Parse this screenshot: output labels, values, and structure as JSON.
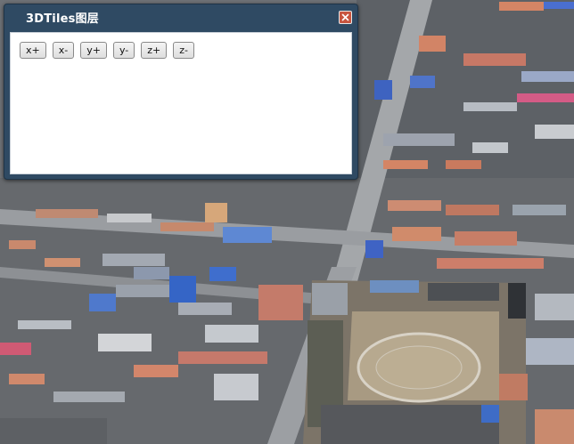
{
  "panel": {
    "title": "3DTiles图层",
    "close_icon": "close-icon"
  },
  "toolbar": {
    "buttons": [
      {
        "label": "x+"
      },
      {
        "label": "x-"
      },
      {
        "label": "y+"
      },
      {
        "label": "y-"
      },
      {
        "label": "z+"
      },
      {
        "label": "z-"
      }
    ]
  },
  "colors": {
    "panel_frame": "#2f4a63",
    "close_button": "#c8553f",
    "panel_body": "#ffffff"
  }
}
